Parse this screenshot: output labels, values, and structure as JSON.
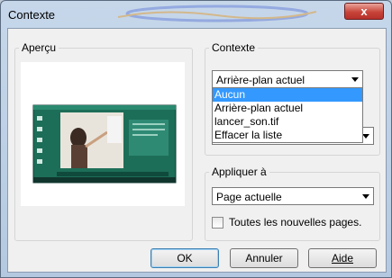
{
  "window": {
    "title": "Contexte",
    "close_glyph": "x"
  },
  "preview_group": {
    "label": "Aperçu"
  },
  "context_group": {
    "label": "Contexte",
    "selected": "Arrière-plan actuel",
    "options": [
      "Aucun",
      "Arrière-plan actuel",
      "lancer_son.tif",
      "Effacer la liste"
    ],
    "highlighted_index": 0
  },
  "apply_group": {
    "label": "Appliquer à",
    "selected": "Page actuelle",
    "checkbox_label": "Toutes les nouvelles pages.",
    "checkbox_checked": false
  },
  "buttons": {
    "ok": "OK",
    "cancel": "Annuler",
    "help": "Aide"
  },
  "colors": {
    "selection": "#3399ff",
    "close_button": "#c8453a"
  }
}
